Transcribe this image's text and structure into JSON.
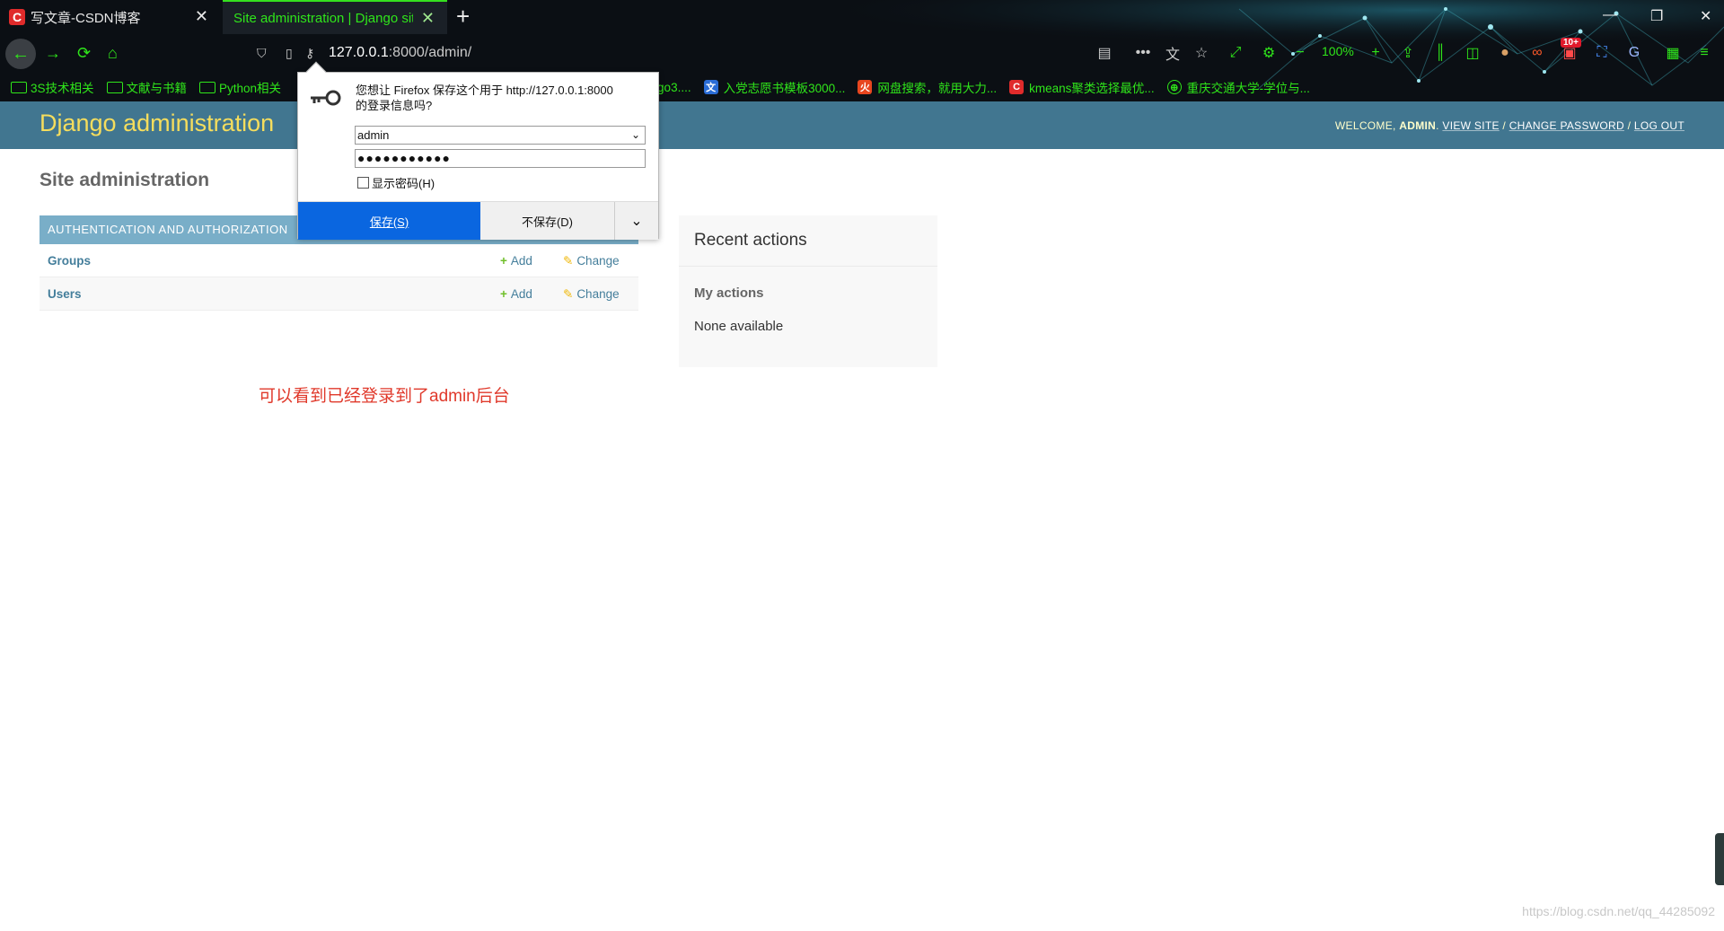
{
  "browser": {
    "tabs": [
      {
        "title": "写文章-CSDN博客",
        "favicon": "C"
      },
      {
        "title": "Site administration | Django site admin",
        "favicon": ""
      }
    ],
    "url_host": "127.0.0.1",
    "url_rest": ":8000/admin/",
    "zoom": "100%",
    "badge": "10+",
    "bookmarks": [
      {
        "label": "3S技术相关",
        "type": "folder"
      },
      {
        "label": "文献与书籍",
        "type": "folder"
      },
      {
        "label": "Python相关",
        "type": "folder"
      },
      {
        "label": "go3....",
        "type": "partial"
      },
      {
        "label": "入党志愿书模板3000...",
        "type": "site",
        "color": "#2a6cd6"
      },
      {
        "label": "网盘搜索，就用大力...",
        "type": "site",
        "color": "#e8461f"
      },
      {
        "label": "kmeans聚类选择最优...",
        "type": "site",
        "color": "#e02b2b"
      },
      {
        "label": "重庆交通大学-学位与...",
        "type": "site",
        "color": "#2fe61a"
      }
    ],
    "accent_color": "#2fe61a"
  },
  "popup": {
    "message_line1": "您想让 Firefox 保存这个用于 http://127.0.0.1:8000",
    "message_line2": "的登录信息吗?",
    "username": "admin",
    "password_mask": "●●●●●●●●●●●",
    "show_password": "显示密码(H)",
    "save_label": "保存(S)",
    "nosave_label": "不保存(D)"
  },
  "django": {
    "branding": "Django administration",
    "welcome": "WELCOME, ",
    "user": "ADMIN",
    "view_site": "VIEW SITE",
    "change_password": "CHANGE PASSWORD",
    "log_out": "LOG OUT",
    "page_title": "Site administration",
    "module_caption": "AUTHENTICATION AND AUTHORIZATION",
    "rows": [
      {
        "name": "Groups",
        "add": "Add",
        "change": "Change"
      },
      {
        "name": "Users",
        "add": "Add",
        "change": "Change"
      }
    ],
    "recent_title": "Recent actions",
    "my_actions": "My actions",
    "none_available": "None available",
    "header_color": "#417690",
    "caption_color": "#79aec8"
  },
  "annotation": "可以看到已经登录到了admin后台",
  "watermark": "https://blog.csdn.net/qq_44285092"
}
